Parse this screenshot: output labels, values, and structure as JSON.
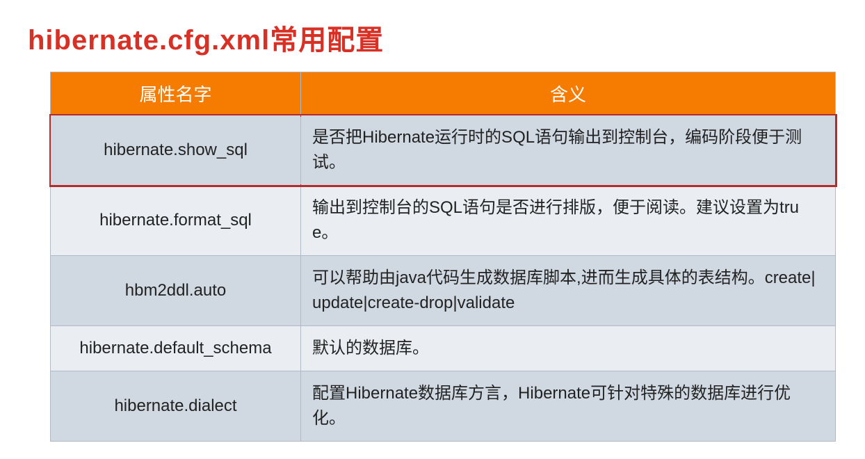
{
  "title": "hibernate.cfg.xml常用配置",
  "headers": {
    "name": "属性名字",
    "meaning": "含义"
  },
  "rows": [
    {
      "name": "hibernate.show_sql",
      "meaning": "是否把Hibernate运行时的SQL语句输出到控制台，编码阶段便于测试。",
      "highlighted": true
    },
    {
      "name": "hibernate.format_sql",
      "meaning": "输出到控制台的SQL语句是否进行排版，便于阅读。建议设置为true。",
      "highlighted": false
    },
    {
      "name": "hbm2ddl.auto",
      "meaning": "可以帮助由java代码生成数据库脚本,进而生成具体的表结构。create|update|create-drop|validate",
      "highlighted": false
    },
    {
      "name": "hibernate.default_schema",
      "meaning": "默认的数据库。",
      "highlighted": false
    },
    {
      "name": "hibernate.dialect",
      "meaning": "配置Hibernate数据库方言，Hibernate可针对特殊的数据库进行优化。",
      "highlighted": false
    }
  ]
}
